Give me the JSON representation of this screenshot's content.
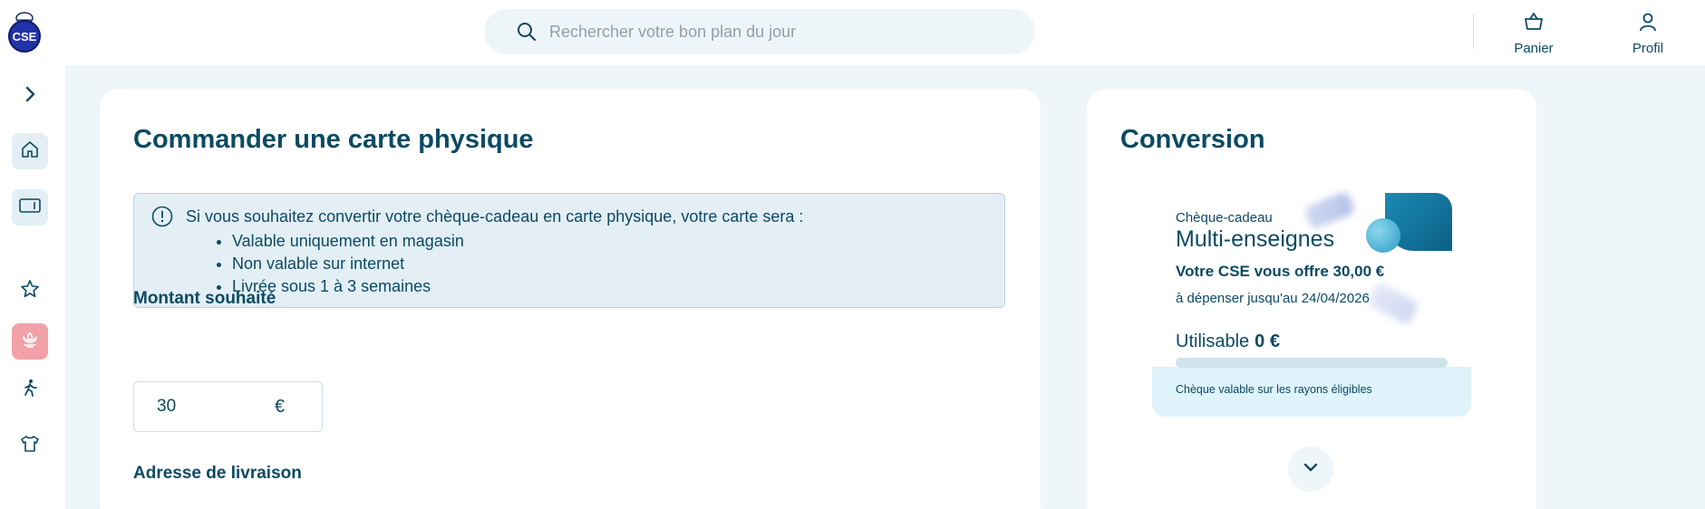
{
  "header": {
    "logo_text": "CSE",
    "search": {
      "placeholder": "Rechercher votre bon plan du jour"
    },
    "cart_label": "Panier",
    "profile_label": "Profil"
  },
  "sidebar": {
    "items": [
      {
        "icon": "chevron-right-icon"
      },
      {
        "icon": "home-icon"
      },
      {
        "icon": "card-icon"
      },
      {
        "icon": "star-icon"
      },
      {
        "icon": "flower-icon"
      },
      {
        "icon": "walking-icon"
      },
      {
        "icon": "tshirt-icon"
      }
    ]
  },
  "order": {
    "title": "Commander une carte physique",
    "info": {
      "intro": "Si vous souhaitez convertir votre chèque-cadeau en carte physique, votre carte sera :",
      "bullets": [
        "Valable uniquement en magasin",
        "Non valable sur internet",
        "Livrée sous 1 à 3 semaines"
      ]
    },
    "amount_label": "Montant souhaité",
    "amount_value": "30",
    "currency": "€",
    "address_label": "Adresse de livraison"
  },
  "conversion": {
    "title": "Conversion",
    "gift": {
      "type": "Chèque-cadeau",
      "name": "Multi-enseignes",
      "offer": "Votre CSE vous offre 30,00 €",
      "valid_until": "à dépenser jusqu'au 24/04/2026",
      "usable_label": "Utilisable",
      "usable_value": "0 €",
      "usable_fraction": 0,
      "footer": "Chèque valable sur les rayons éligibles"
    }
  },
  "colors": {
    "primary_text": "#0b4a63",
    "accent_pink": "#f0a2a8",
    "page_bg": "#eef6fa"
  }
}
